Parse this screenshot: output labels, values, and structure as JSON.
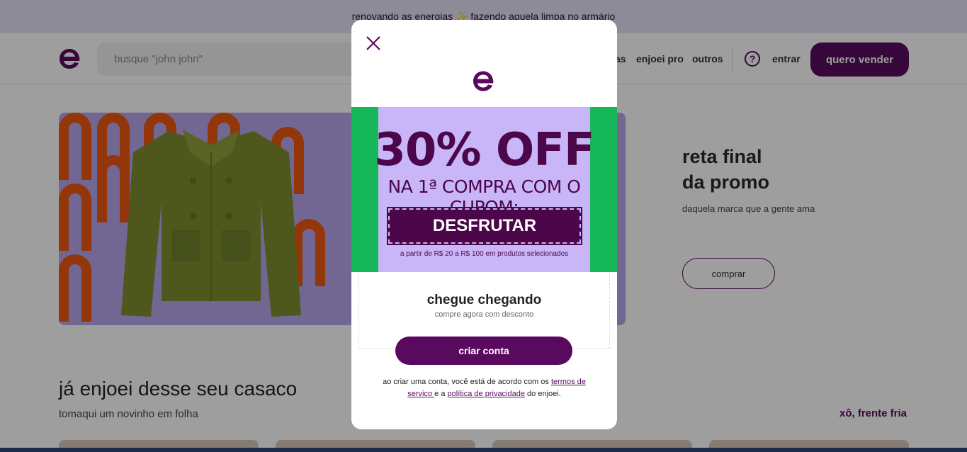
{
  "announcement": {
    "text": "renovando as energias ✨ fazendo aquela limpa no armário"
  },
  "header": {
    "search_placeholder": "busque \"john john\"",
    "nav_items": [
      "as",
      "enjoei pro",
      "outros"
    ],
    "help_symbol": "?",
    "login_label": "entrar",
    "sell_label": "quero vender"
  },
  "hero": {
    "title_line1": "reta final",
    "title_line2": "da promo",
    "subtitle": "daquela marca que a gente ama",
    "button_label": "comprar"
  },
  "section": {
    "title": "já enjoei desse seu casaco",
    "subtitle": "tomaqui um novinho em folha",
    "link": "xô, frente fria"
  },
  "modal": {
    "close_icon": "close-icon",
    "banner": {
      "headline": "30% OFF",
      "coupon_line": "NA 1ª COMPRA COM O CUPOM:",
      "coupon_code": "DESFRUTAR",
      "fine_print": "a partir de R$ 20 a R$ 100 em produtos selecionados"
    },
    "title": "chegue chegando",
    "subtitle": "compre agora com desconto",
    "cta_label": "criar conta",
    "legal_part1": "ao criar uma conta, você está de acordo com os ",
    "terms_link": "termos de serviço ",
    "legal_part2": "e a ",
    "privacy_link": "política de privacidade",
    "legal_part3": " do enjoei."
  },
  "colors": {
    "brand": "#5a0a5e",
    "banner_bg": "#c9b6f8",
    "banner_green": "#16b85a",
    "hero_orange": "#ee5a12"
  }
}
